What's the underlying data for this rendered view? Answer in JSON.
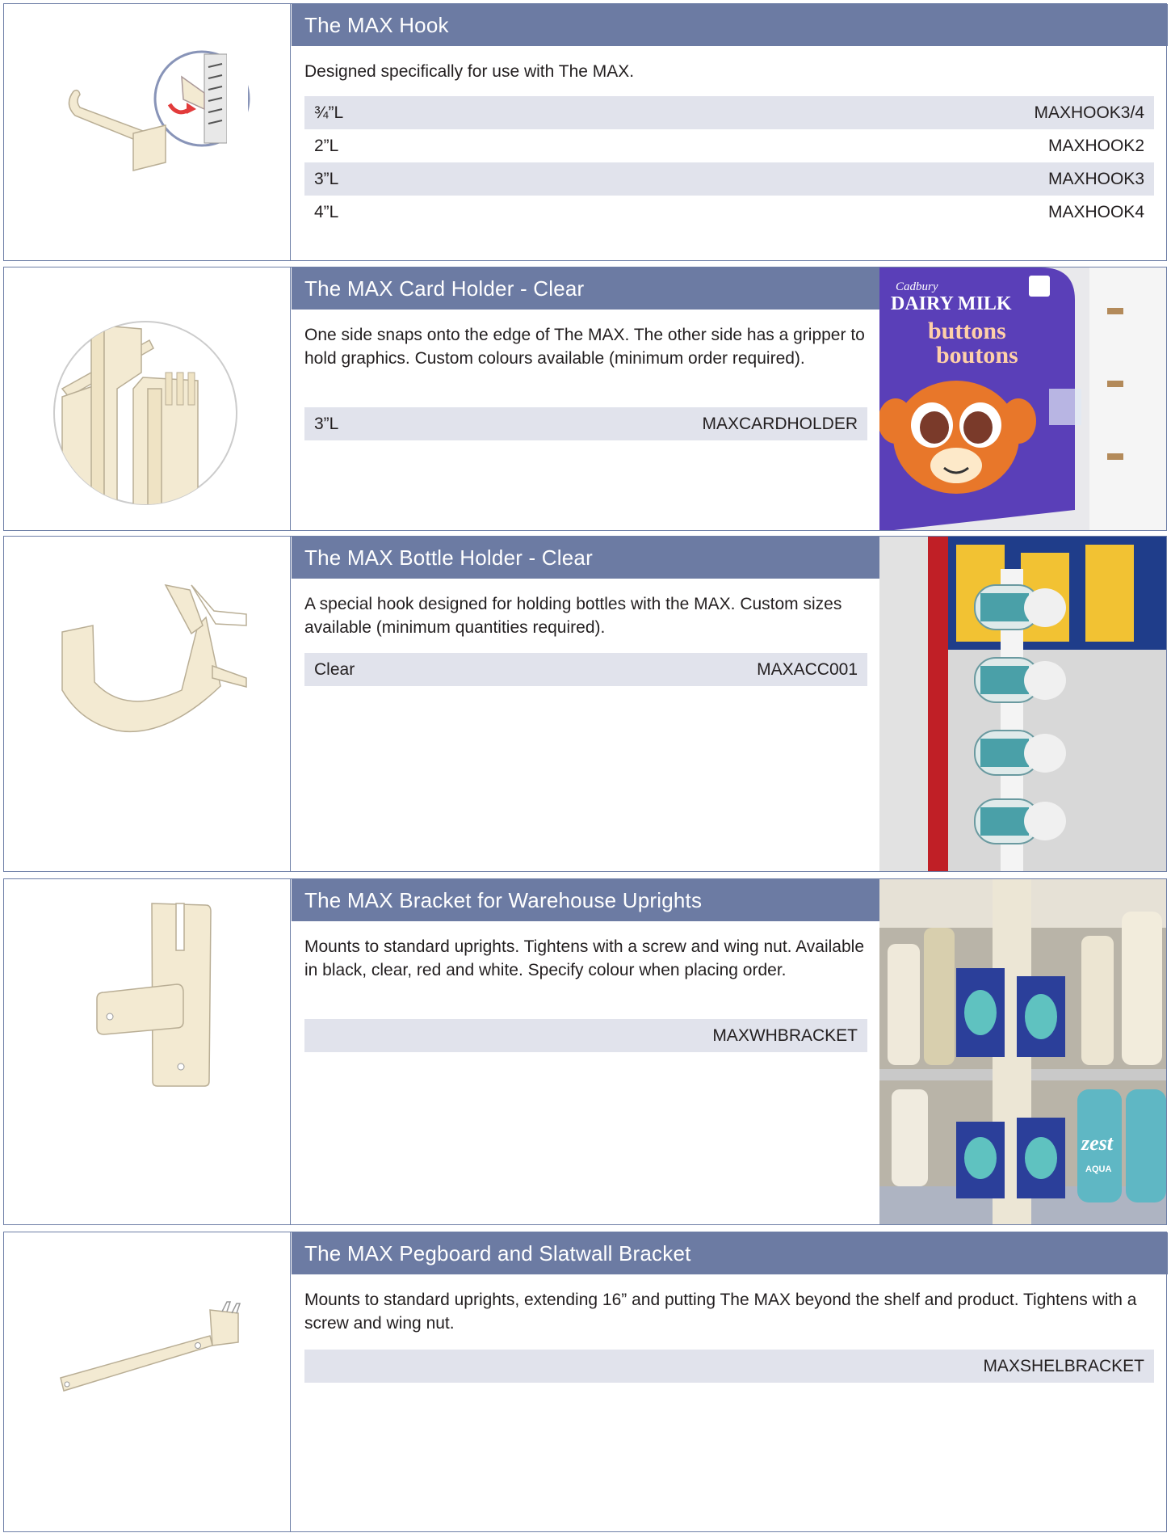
{
  "products": [
    {
      "title": "The MAX Hook",
      "description": "Designed specifically for use with The MAX.",
      "rows": [
        {
          "size": "¾”L",
          "code": "MAXHOOK3/4"
        },
        {
          "size": "2”L",
          "code": "MAXHOOK2"
        },
        {
          "size": "3”L",
          "code": "MAXHOOK3"
        },
        {
          "size": "4”L",
          "code": "MAXHOOK4"
        }
      ]
    },
    {
      "title": "The MAX Card Holder - Clear",
      "description": "One side snaps onto the edge of The MAX. The other side has a gripper to hold graphics. Custom colours available (minimum order required).",
      "rows": [
        {
          "size": "3”L",
          "code": "MAXCARDHOLDER"
        }
      ],
      "photo_text": {
        "brand": "Cadbury",
        "line1": "DAIRY MILK",
        "line2": "buttons",
        "line3": "boutons"
      }
    },
    {
      "title": "The MAX Bottle Holder - Clear",
      "description": "A special hook designed for holding bottles with the MAX. Custom sizes available (minimum quantities required).",
      "rows": [
        {
          "size": "Clear",
          "code": "MAXACC001"
        }
      ]
    },
    {
      "title": "The MAX Bracket for Warehouse Uprights",
      "description": "Mounts to standard uprights. Tightens with a screw and wing nut. Available in black, clear, red and white. Specify colour when placing order.",
      "rows": [
        {
          "size": "",
          "code": "MAXWHBRACKET"
        }
      ],
      "photo_text": {
        "label1": "zest",
        "label2": "AQUA"
      }
    },
    {
      "title": "The MAX Pegboard and Slatwall Bracket",
      "description": "Mounts to standard uprights, extending 16” and putting The MAX beyond the shelf and product. Tightens with a screw and wing nut.",
      "rows": [
        {
          "size": "",
          "code": "MAXSHELBRACKET"
        }
      ]
    }
  ],
  "colors": {
    "title_bar": "#6c7ba3",
    "row_shade": "#e1e3ec",
    "border": "#6d7ea6",
    "part": "#f3ead2"
  }
}
